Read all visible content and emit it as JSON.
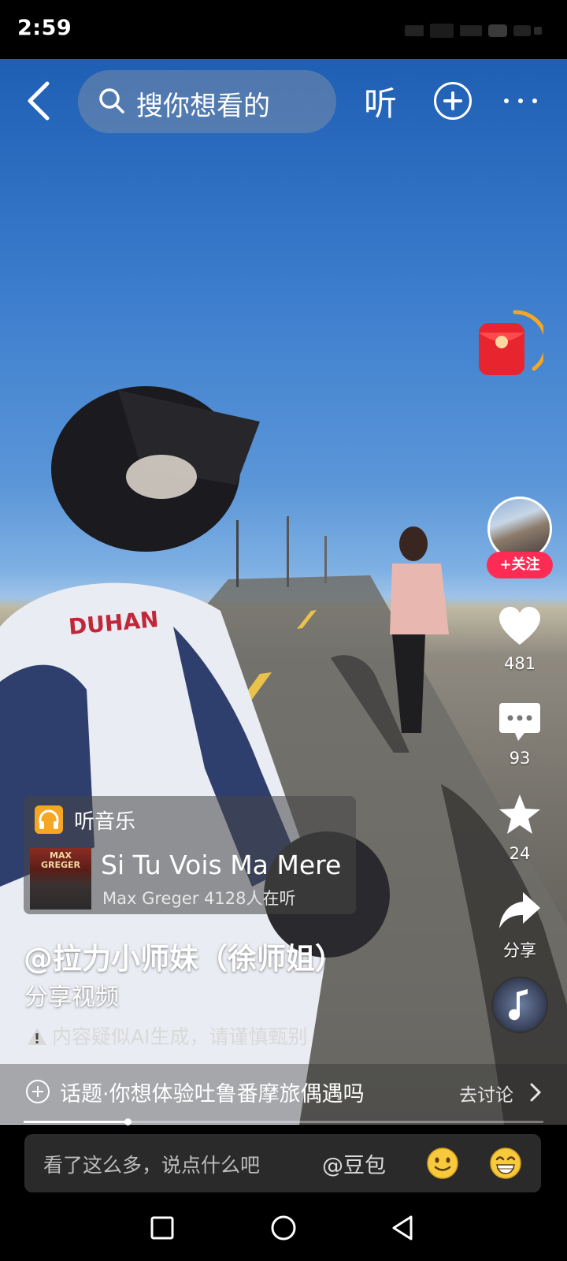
{
  "status_bar": {
    "time": "2:59"
  },
  "top_bar": {
    "search_placeholder": "搜你想看的",
    "listen_label": "听"
  },
  "side_bar": {
    "follow_label": "+关注",
    "like_count": "481",
    "comment_count": "93",
    "favorite_count": "24",
    "share_label": "分享"
  },
  "music_card": {
    "tag": "听音乐",
    "album_art_text": "MAX GREGER",
    "song_title": "Si Tu Vois Ma Mere",
    "artist_listeners": "Max Greger 4128人在听"
  },
  "post": {
    "author": "@拉力小师妹（徐师姐）",
    "caption": "分享视频",
    "ai_notice": "内容疑似AI生成，请谨慎甄别"
  },
  "topic": {
    "text": "话题·你想体验吐鲁番摩旅偶遇吗",
    "link": "去讨论"
  },
  "progress": {
    "fraction": 0.2
  },
  "comment_bar": {
    "placeholder": "看了这么多，说点什么吧",
    "mention": "@豆包"
  },
  "colors": {
    "accent": "#fe2c55",
    "music_tag": "#f5a623"
  }
}
